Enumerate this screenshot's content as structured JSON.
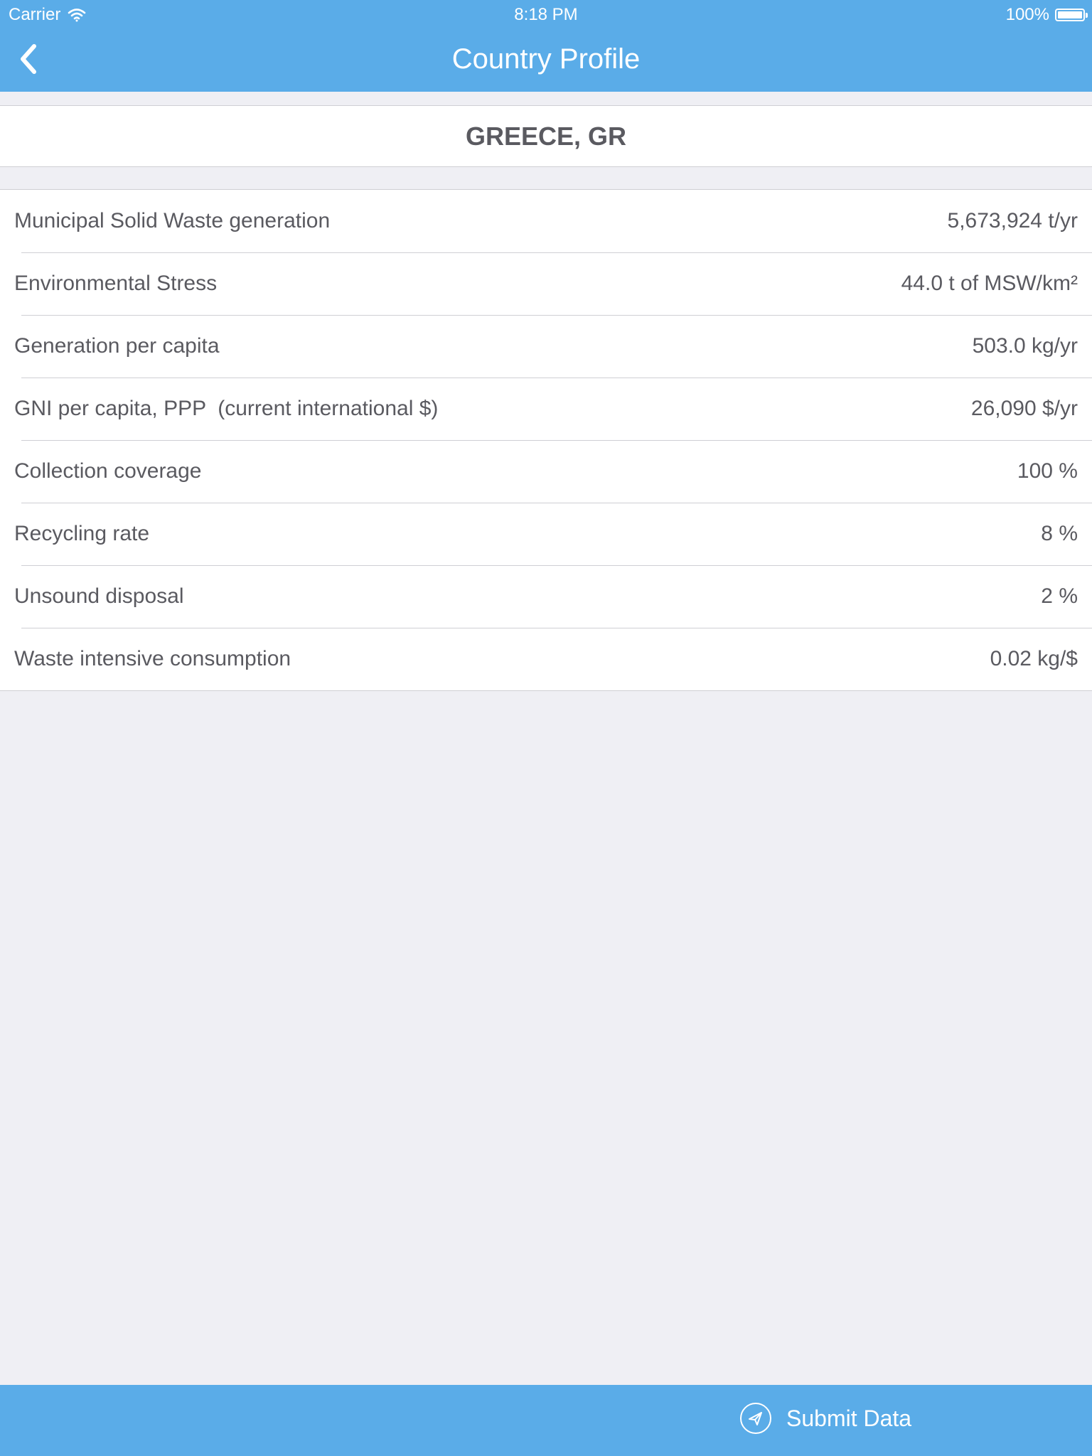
{
  "status_bar": {
    "carrier": "Carrier",
    "time": "8:18 PM",
    "battery": "100%"
  },
  "nav": {
    "title": "Country Profile"
  },
  "country": {
    "name": "GREECE, GR"
  },
  "rows": [
    {
      "label": "Municipal Solid Waste generation",
      "value": "5,673,924 t/yr"
    },
    {
      "label": "Environmental Stress",
      "value": "44.0 t of MSW/km²"
    },
    {
      "label": "Generation per capita",
      "value": "503.0 kg/yr"
    },
    {
      "label": "GNI per capita, PPP  (current international $)",
      "value": "26,090 $/yr"
    },
    {
      "label": "Collection coverage",
      "value": "100 %"
    },
    {
      "label": "Recycling rate",
      "value": "8 %"
    },
    {
      "label": "Unsound disposal",
      "value": "2 %"
    },
    {
      "label": "Waste intensive consumption",
      "value": "0.02 kg/$"
    }
  ],
  "footer": {
    "submit_label": "Submit Data"
  },
  "colors": {
    "accent": "#5aace8",
    "background": "#efeff4",
    "text": "#5a5a60"
  },
  "icons": {
    "back": "chevron-left-icon",
    "wifi": "wifi-icon",
    "battery": "battery-icon",
    "submit": "send-icon"
  }
}
